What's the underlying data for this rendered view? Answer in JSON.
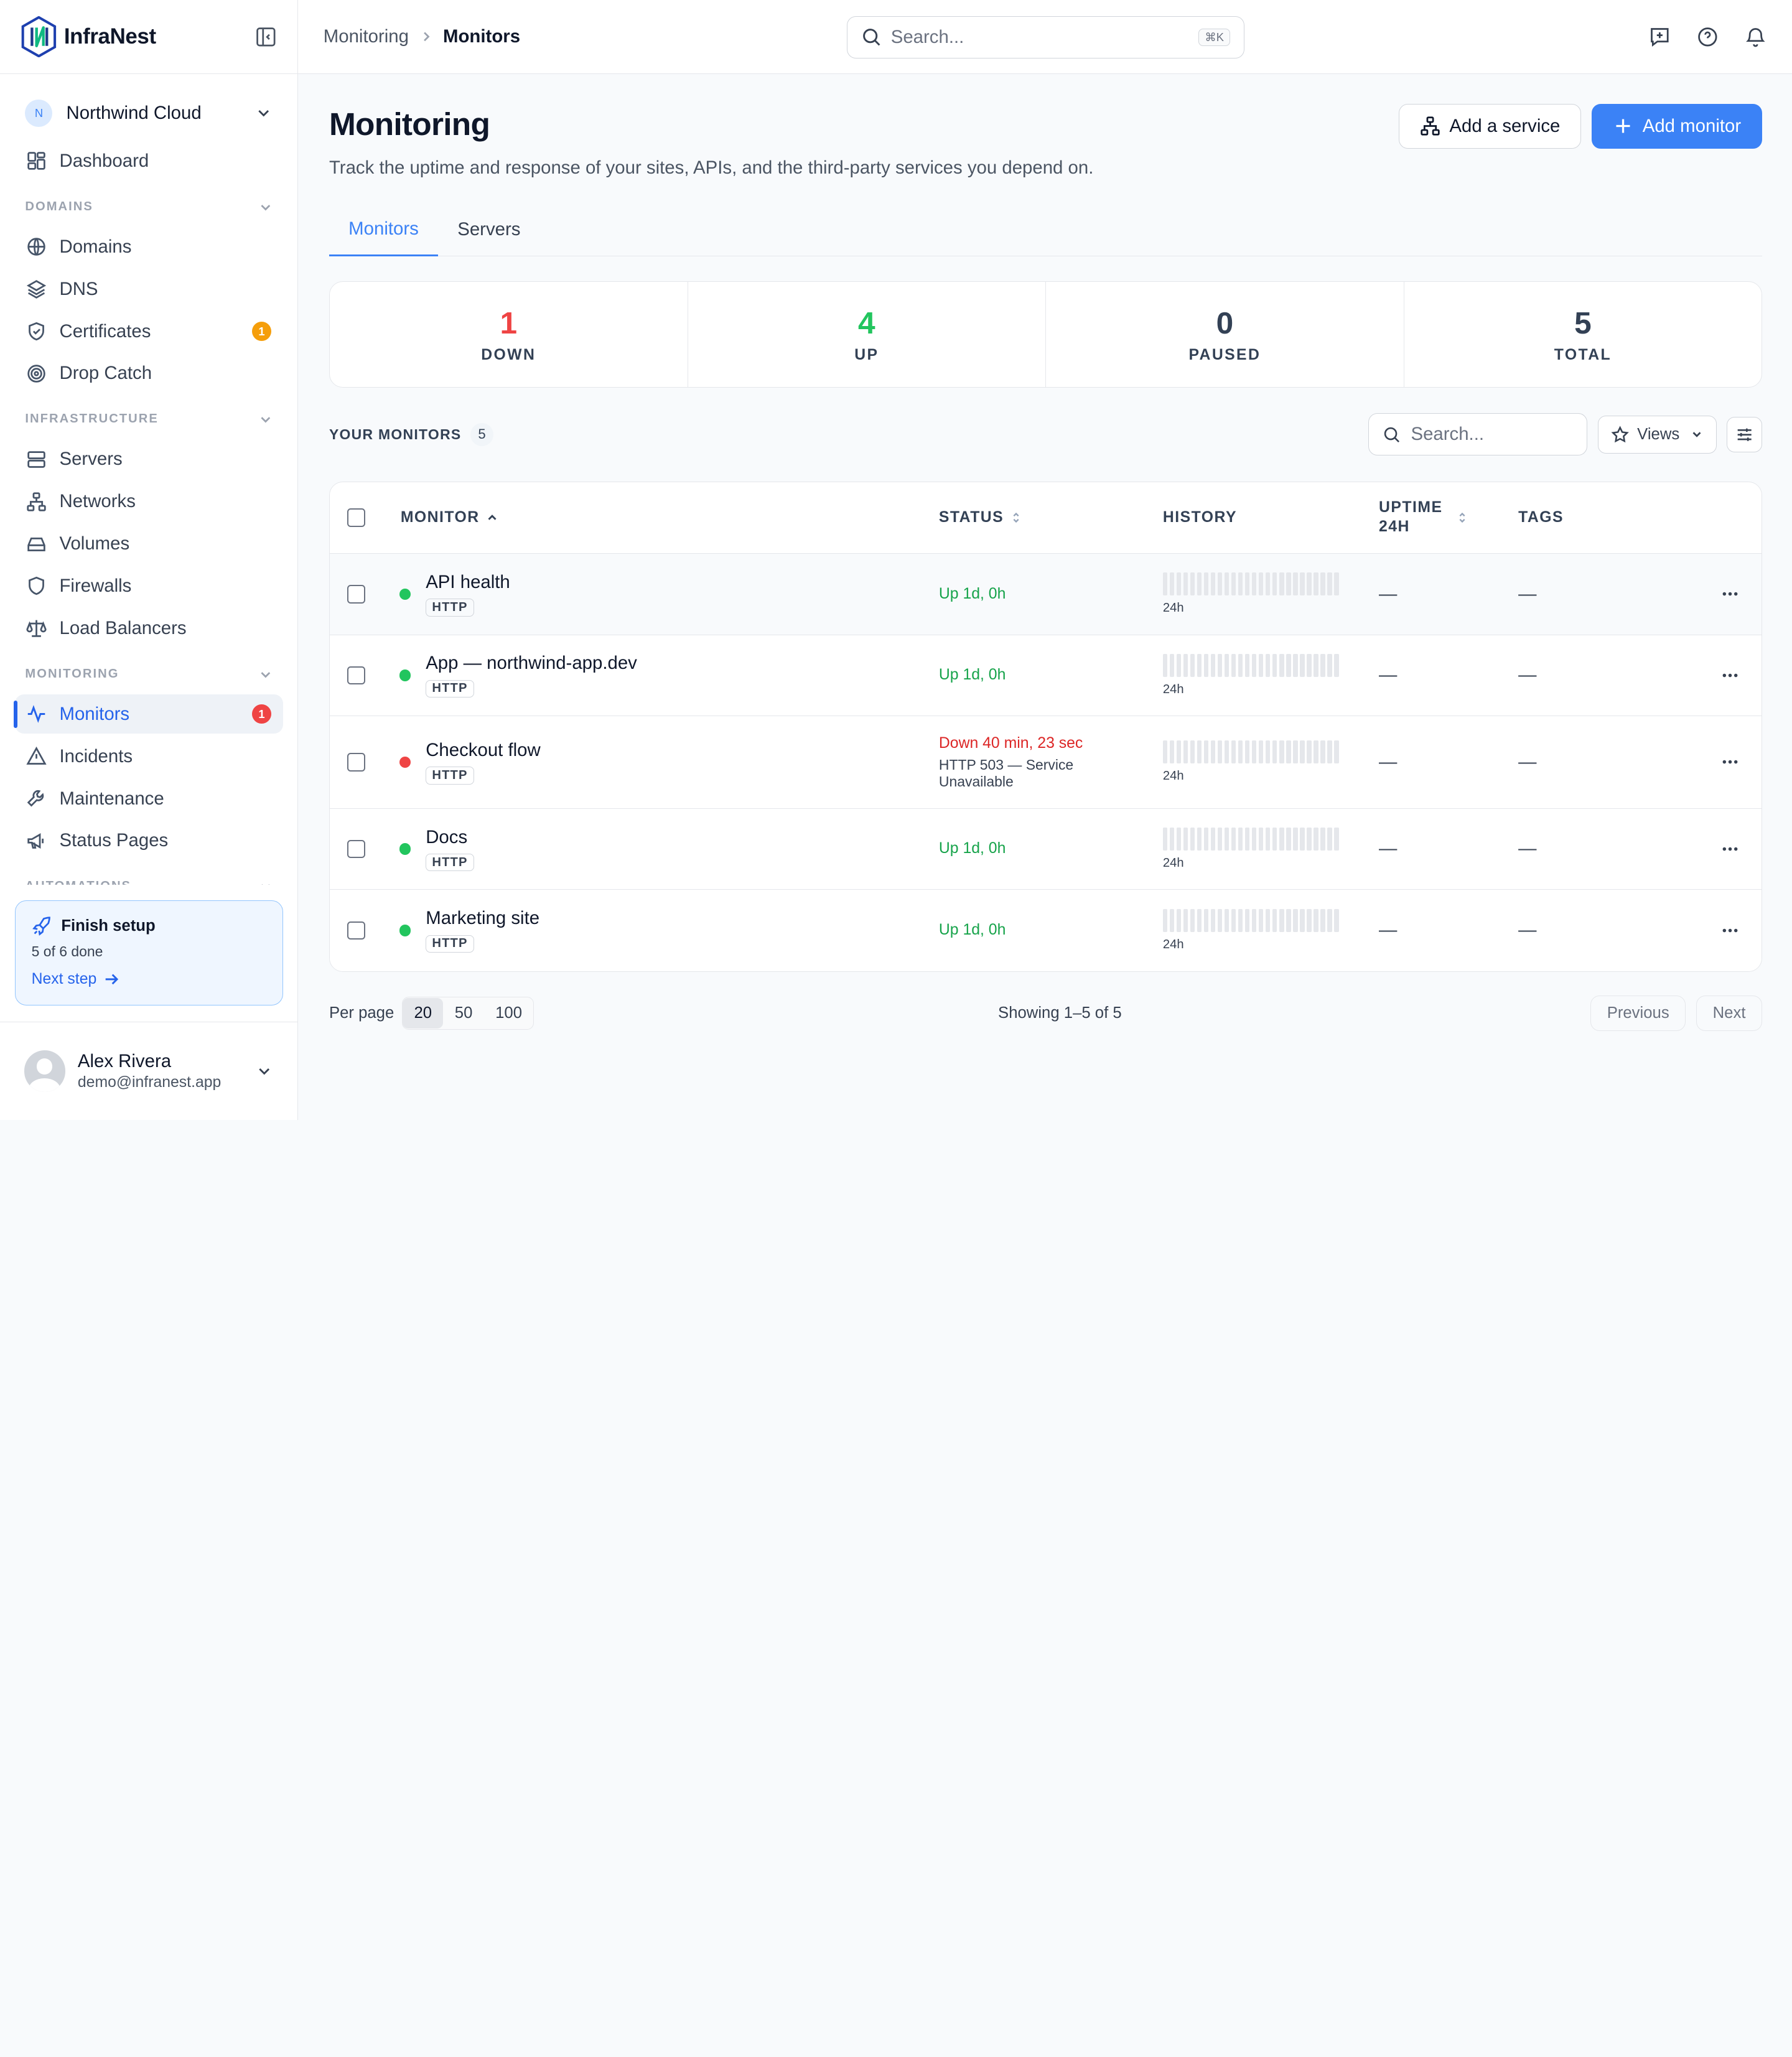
{
  "brand": {
    "name": "InfraNest"
  },
  "org": {
    "initial": "N",
    "name": "Northwind Cloud"
  },
  "nav": {
    "dashboard": "Dashboard",
    "sections": {
      "domains": "DOMAINS",
      "infrastructure": "INFRASTRUCTURE",
      "monitoring": "MONITORING",
      "automations": "AUTOMATIONS"
    },
    "domains": "Domains",
    "dns": "DNS",
    "certificates": "Certificates",
    "certificates_badge": "1",
    "drop_catch": "Drop Catch",
    "servers": "Servers",
    "networks": "Networks",
    "volumes": "Volumes",
    "firewalls": "Firewalls",
    "load_balancers": "Load Balancers",
    "monitors": "Monitors",
    "monitors_badge": "1",
    "incidents": "Incidents",
    "maintenance": "Maintenance",
    "status_pages": "Status Pages"
  },
  "setup": {
    "title": "Finish setup",
    "progress": "5 of 6 done",
    "progress_fraction": 0.833,
    "next": "Next step"
  },
  "user": {
    "name": "Alex Rivera",
    "email": "demo@infranest.app"
  },
  "breadcrumb": {
    "parent": "Monitoring",
    "current": "Monitors"
  },
  "search": {
    "placeholder": "Search...",
    "shortcut": "⌘K"
  },
  "page": {
    "title": "Monitoring",
    "description": "Track the uptime and response of your sites, APIs, and the third-party services you depend on.",
    "add_service": "Add a service",
    "add_monitor": "Add monitor"
  },
  "tabs": [
    "Monitors",
    "Servers"
  ],
  "stats": [
    {
      "value": "1",
      "label": "DOWN",
      "color": "#ef4444"
    },
    {
      "value": "4",
      "label": "UP",
      "color": "#22c55e"
    },
    {
      "value": "0",
      "label": "PAUSED",
      "color": "#334155"
    },
    {
      "value": "5",
      "label": "TOTAL",
      "color": "#334155"
    }
  ],
  "list": {
    "title": "YOUR MONITORS",
    "count": "5",
    "search_placeholder": "Search...",
    "views_label": "Views"
  },
  "table": {
    "headers": {
      "monitor": "MONITOR",
      "status": "STATUS",
      "history": "HISTORY",
      "uptime": "UPTIME 24H",
      "tags": "TAGS"
    },
    "rows": [
      {
        "name": "API health",
        "type": "HTTP",
        "state": "up",
        "status": "Up 1d, 0h",
        "detail": "",
        "history_label": "24h",
        "uptime": "—",
        "tags": "—"
      },
      {
        "name": "App — northwind-app.dev",
        "type": "HTTP",
        "state": "up",
        "status": "Up 1d, 0h",
        "detail": "",
        "history_label": "24h",
        "uptime": "—",
        "tags": "—"
      },
      {
        "name": "Checkout flow",
        "type": "HTTP",
        "state": "down",
        "status": "Down 40 min, 23 sec",
        "detail": "HTTP 503 — Service Unavailable",
        "history_label": "24h",
        "uptime": "—",
        "tags": "—"
      },
      {
        "name": "Docs",
        "type": "HTTP",
        "state": "up",
        "status": "Up 1d, 0h",
        "detail": "",
        "history_label": "24h",
        "uptime": "—",
        "tags": "—"
      },
      {
        "name": "Marketing site",
        "type": "HTTP",
        "state": "up",
        "status": "Up 1d, 0h",
        "detail": "",
        "history_label": "24h",
        "uptime": "—",
        "tags": "—"
      }
    ]
  },
  "pagination": {
    "per_page_label": "Per page",
    "options": [
      "20",
      "50",
      "100"
    ],
    "selected": "20",
    "showing": "Showing 1–5 of 5",
    "previous": "Previous",
    "next": "Next"
  }
}
